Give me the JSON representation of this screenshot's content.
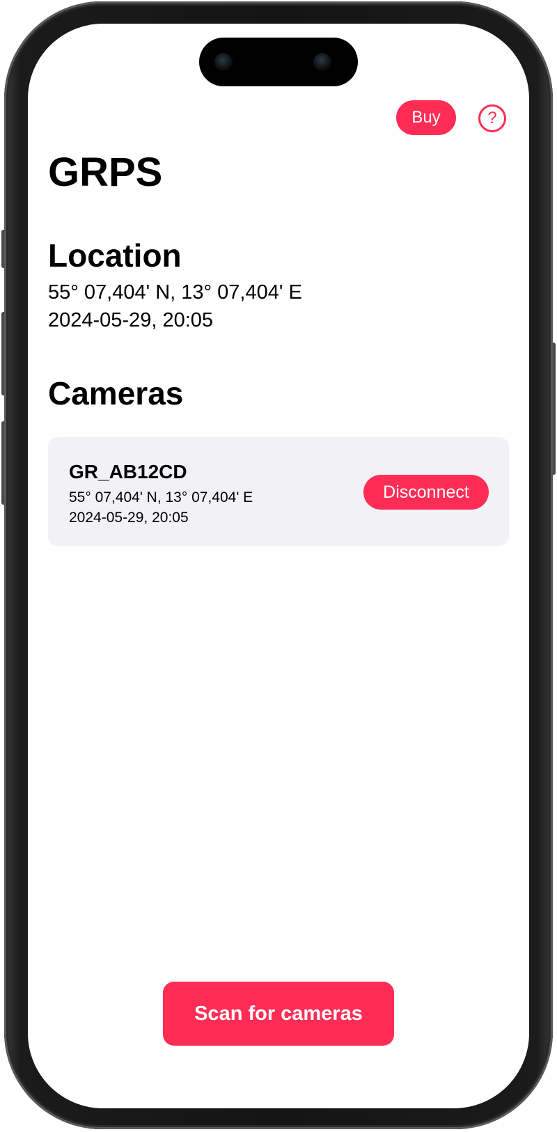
{
  "header": {
    "buy_label": "Buy",
    "help_icon": "question-circle-icon",
    "help_glyph": "?"
  },
  "page": {
    "title": "GRPS"
  },
  "location": {
    "heading": "Location",
    "coordinates": "55° 07,404' N, 13° 07,404' E",
    "timestamp": "2024-05-29, 20:05"
  },
  "cameras": {
    "heading": "Cameras",
    "items": [
      {
        "name": "GR_AB12CD",
        "coordinates": "55° 07,404' N, 13° 07,404' E",
        "timestamp": "2024-05-29, 20:05",
        "action_label": "Disconnect"
      }
    ]
  },
  "footer": {
    "scan_label": "Scan for cameras"
  },
  "colors": {
    "accent": "#ff2d55",
    "card_background": "#f2f1f6",
    "text": "#000000"
  }
}
